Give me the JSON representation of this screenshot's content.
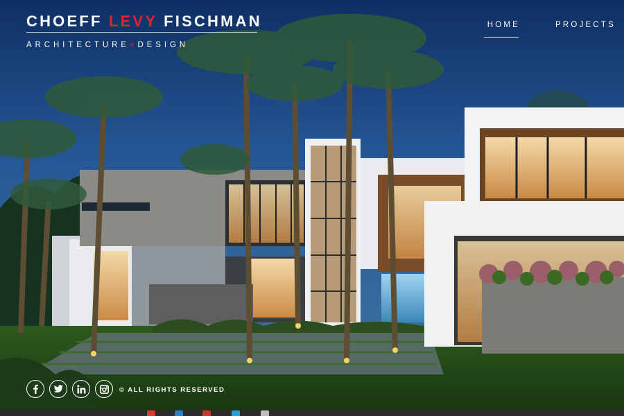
{
  "brand": {
    "name_part1": "CHOEFF ",
    "name_part2": "LEVY",
    "name_part3": " FISCHMAN",
    "tagline_part1": "ARCHITECTURE",
    "tagline_plus": "+",
    "tagline_part2": "DESIGN",
    "accent_color": "#e0242d"
  },
  "nav": {
    "items": [
      {
        "label": "HOME",
        "active": true
      },
      {
        "label": "PROJECTS",
        "active": false
      }
    ]
  },
  "footer": {
    "social": [
      {
        "icon": "facebook-icon"
      },
      {
        "icon": "twitter-icon"
      },
      {
        "icon": "linkedin-icon"
      },
      {
        "icon": "instagram-icon"
      }
    ],
    "copyright": "© ALL RIGHTS RESERVED"
  },
  "taskbar": {
    "icons": [
      "chrome-icon",
      "app-icon",
      "app-icon",
      "app-icon",
      "app-icon",
      "app-icon"
    ]
  }
}
